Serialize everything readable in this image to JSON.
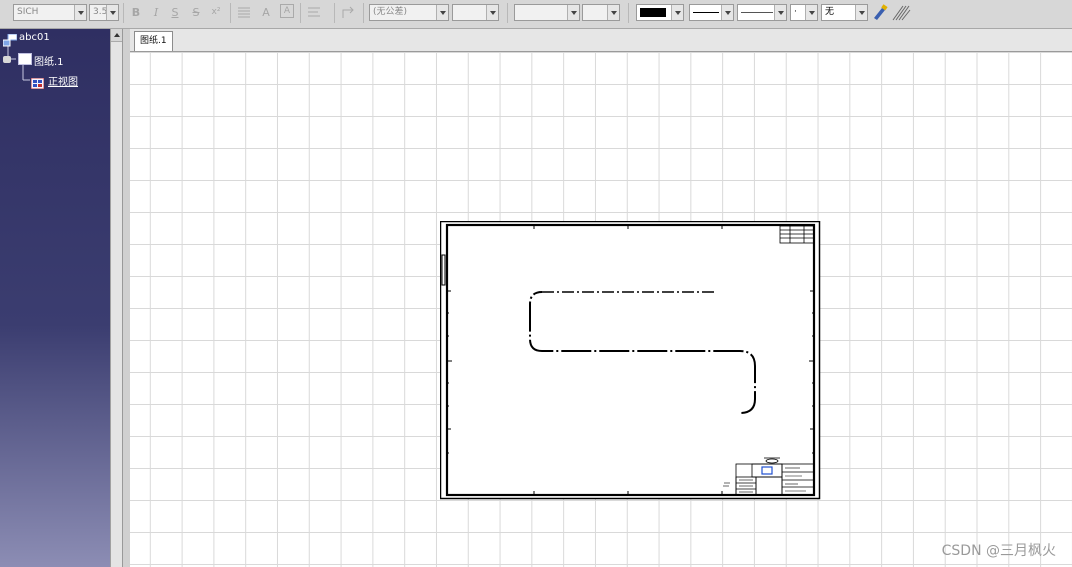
{
  "toolbar": {
    "font_name": "SICH",
    "font_size": "3.5",
    "bold": "B",
    "italic": "I",
    "underline": "S",
    "strike": "S",
    "superscript": "x²",
    "frame_label": "A",
    "frame2_label": "A",
    "tolerance": "(无公差)",
    "fill_none": "无",
    "line_dot": "·"
  },
  "tree": {
    "root": "abc01",
    "sheet": "图纸.1",
    "view": "正视图"
  },
  "tabs": [
    {
      "label": "图纸.1",
      "active": true
    }
  ],
  "watermark": "CSDN @三月枫火",
  "colors": {
    "tree_bg_top": "#2f2f62",
    "tree_bg_bottom": "#8c8db4",
    "grid": "#d9d9d9"
  }
}
